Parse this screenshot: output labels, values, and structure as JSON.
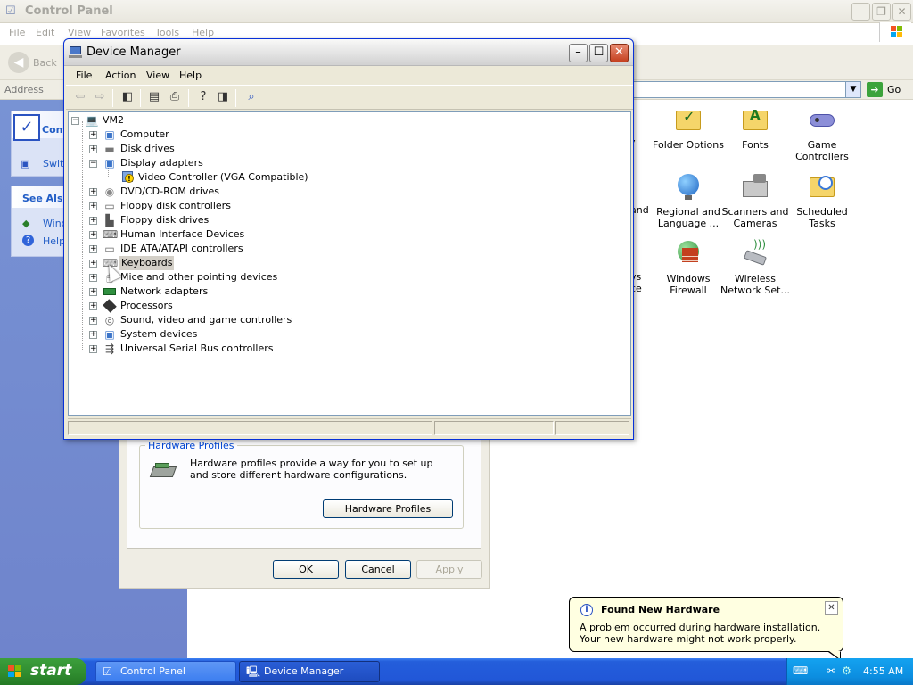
{
  "control_panel": {
    "title": "Control Panel",
    "menu": [
      "File",
      "Edit",
      "View",
      "Favorites",
      "Tools",
      "Help"
    ],
    "back_label": "Back",
    "address_label": "Address",
    "go_label": "Go",
    "left_panel": {
      "title_partial": "Cont",
      "switch_partial": "Switc",
      "see_also_partial": "See Also",
      "see_also_items": [
        "Wind",
        "Help"
      ]
    },
    "icons": [
      {
        "label": "Folder Options",
        "icon": "folder-options-icon"
      },
      {
        "label": "Fonts",
        "icon": "fonts-icon"
      },
      {
        "label": "Game Controllers",
        "icon": "game-controllers-icon"
      },
      {
        "label": "Regional and Language ...",
        "icon": "regional-language-icon"
      },
      {
        "label": "Scanners and Cameras",
        "icon": "scanners-cameras-icon"
      },
      {
        "label": "Scheduled Tasks",
        "icon": "scheduled-tasks-icon"
      },
      {
        "label": "Windows Firewall",
        "icon": "windows-firewall-icon"
      },
      {
        "label": "Wireless Network Set...",
        "icon": "wireless-network-icon"
      }
    ],
    "partial_left_labels": [
      "y",
      "and",
      "vs",
      "ce"
    ]
  },
  "system_properties": {
    "group_title": "Hardware Profiles",
    "description": "Hardware profiles provide a way for you to set up and store different hardware configurations.",
    "hardware_profiles_button": "Hardware Profiles",
    "ok_button": "OK",
    "cancel_button": "Cancel",
    "apply_button": "Apply"
  },
  "device_manager": {
    "title": "Device Manager",
    "menu": [
      "File",
      "Action",
      "View",
      "Help"
    ],
    "root": "VM2",
    "tree": [
      {
        "label": "Computer",
        "icon": "computer-icon",
        "expanded": false
      },
      {
        "label": "Disk drives",
        "icon": "disk-drive-icon",
        "expanded": false
      },
      {
        "label": "Display adapters",
        "icon": "display-adapter-icon",
        "expanded": true,
        "children": [
          {
            "label": "Video Controller (VGA Compatible)",
            "icon": "warning-device-icon"
          }
        ]
      },
      {
        "label": "DVD/CD-ROM drives",
        "icon": "cdrom-icon",
        "expanded": false
      },
      {
        "label": "Floppy disk controllers",
        "icon": "floppy-controller-icon",
        "expanded": false
      },
      {
        "label": "Floppy disk drives",
        "icon": "floppy-drive-icon",
        "expanded": false
      },
      {
        "label": "Human Interface Devices",
        "icon": "hid-icon",
        "expanded": false
      },
      {
        "label": "IDE ATA/ATAPI controllers",
        "icon": "ide-controller-icon",
        "expanded": false
      },
      {
        "label": "Keyboards",
        "icon": "keyboard-icon",
        "expanded": false,
        "selected": true
      },
      {
        "label": "Mice and other pointing devices",
        "icon": "mouse-icon",
        "expanded": false
      },
      {
        "label": "Network adapters",
        "icon": "network-adapter-icon",
        "expanded": false
      },
      {
        "label": "Processors",
        "icon": "processor-icon",
        "expanded": false
      },
      {
        "label": "Sound, video and game controllers",
        "icon": "sound-icon",
        "expanded": false
      },
      {
        "label": "System devices",
        "icon": "system-devices-icon",
        "expanded": false
      },
      {
        "label": "Universal Serial Bus controllers",
        "icon": "usb-icon",
        "expanded": false
      }
    ]
  },
  "balloon": {
    "title": "Found New Hardware",
    "message": "A problem occurred during hardware installation. Your new hardware might not work properly."
  },
  "taskbar": {
    "start_label": "start",
    "tasks": [
      "Control Panel",
      "Device Manager"
    ],
    "clock": "4:55 AM"
  }
}
